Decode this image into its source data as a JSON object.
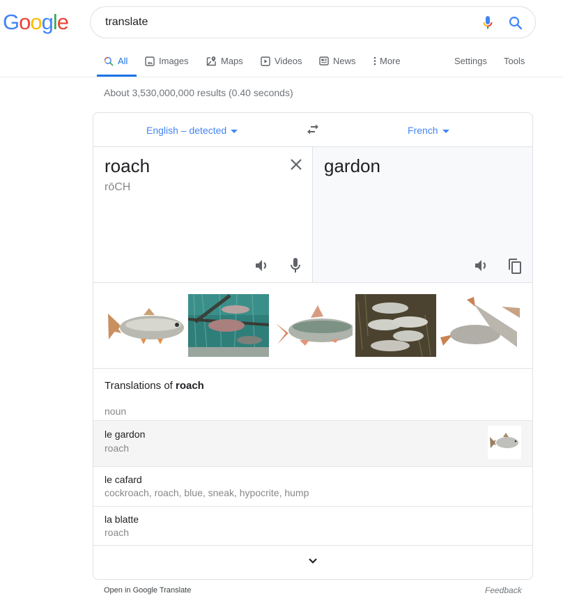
{
  "header": {
    "logo_letters": [
      "G",
      "o",
      "o",
      "g",
      "l",
      "e"
    ],
    "logo_colors": [
      "#4285f4",
      "#ea4335",
      "#fbbc05",
      "#4285f4",
      "#34a853",
      "#ea4335"
    ],
    "search_query": "translate",
    "mic_icon": "microphone-icon",
    "search_icon": "search-icon"
  },
  "tabs": {
    "items": [
      {
        "label": "All",
        "icon": "search-icon",
        "active": true
      },
      {
        "label": "Images",
        "icon": "image-icon"
      },
      {
        "label": "Maps",
        "icon": "map-pin-icon"
      },
      {
        "label": "Videos",
        "icon": "play-icon"
      },
      {
        "label": "News",
        "icon": "newspaper-icon"
      },
      {
        "label": "More",
        "icon": "more-vert-icon"
      }
    ],
    "settings": "Settings",
    "tools": "Tools"
  },
  "stats": "About 3,530,000,000 results (0.40 seconds)",
  "translate": {
    "source_lang": "English – detected",
    "target_lang": "French",
    "source_text": "roach",
    "source_phonetic": "rōCH",
    "target_text": "gardon",
    "accent_color": "#4285f4",
    "image_count": 5
  },
  "translations": {
    "title_prefix": "Translations of ",
    "title_word": "roach",
    "part_of_speech": "noun",
    "entries": [
      {
        "word": "le gardon",
        "meanings": "roach",
        "highlighted": true,
        "has_image": true
      },
      {
        "word": "le cafard",
        "meanings": "cockroach, roach, blue, sneak, hypocrite, hump"
      },
      {
        "word": "la blatte",
        "meanings": "roach"
      }
    ]
  },
  "footer": {
    "open_link": "Open in Google Translate",
    "feedback": "Feedback"
  }
}
